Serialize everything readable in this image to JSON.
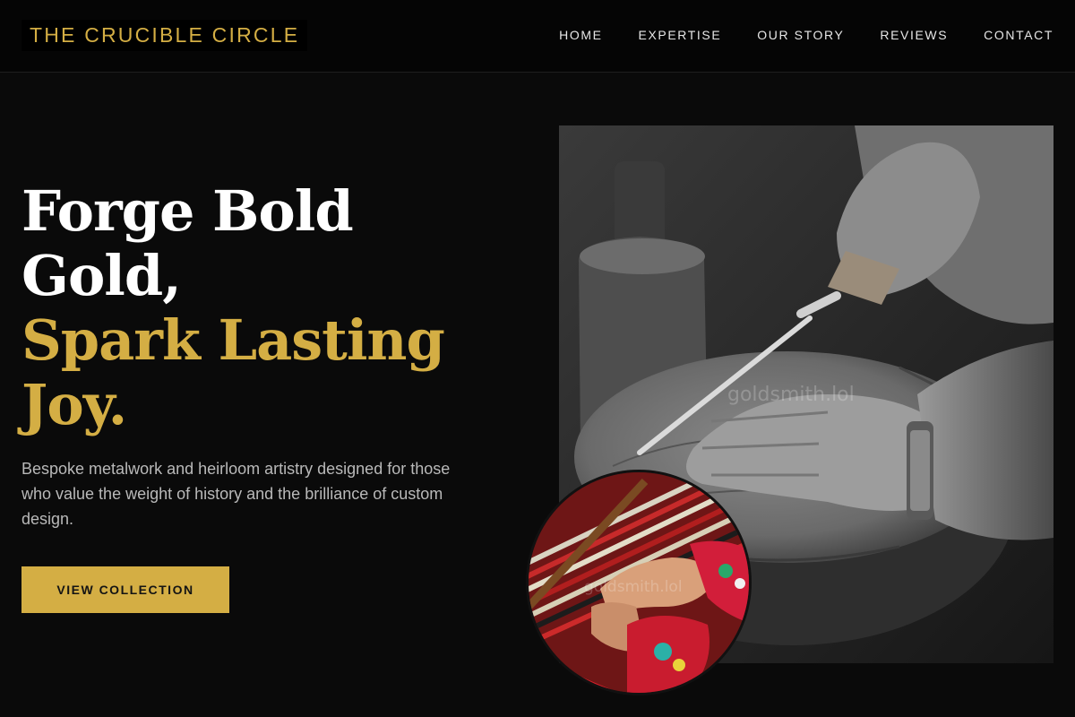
{
  "brand": {
    "logo_text": "THE CRUCIBLE CIRCLE"
  },
  "nav": {
    "items": [
      {
        "label": "HOME"
      },
      {
        "label": "EXPERTISE"
      },
      {
        "label": "OUR STORY"
      },
      {
        "label": "REVIEWS"
      },
      {
        "label": "CONTACT"
      }
    ]
  },
  "hero": {
    "headline_line1": "Forge Bold",
    "headline_line2": "Gold,",
    "headline_accent_line1": "Spark Lasting",
    "headline_accent_line2": "Joy.",
    "subtext": "Bespoke metalwork and heirloom artistry designed for those who value the weight of history and the brilliance of custom design.",
    "cta_label": "VIEW COLLECTION"
  },
  "media": {
    "main_watermark": "goldsmith.lol",
    "circle_watermark": "goldsmith.lol"
  },
  "colors": {
    "accent": "#d4ae44",
    "background": "#0a0a0a",
    "text_muted": "#b9b9b9"
  }
}
